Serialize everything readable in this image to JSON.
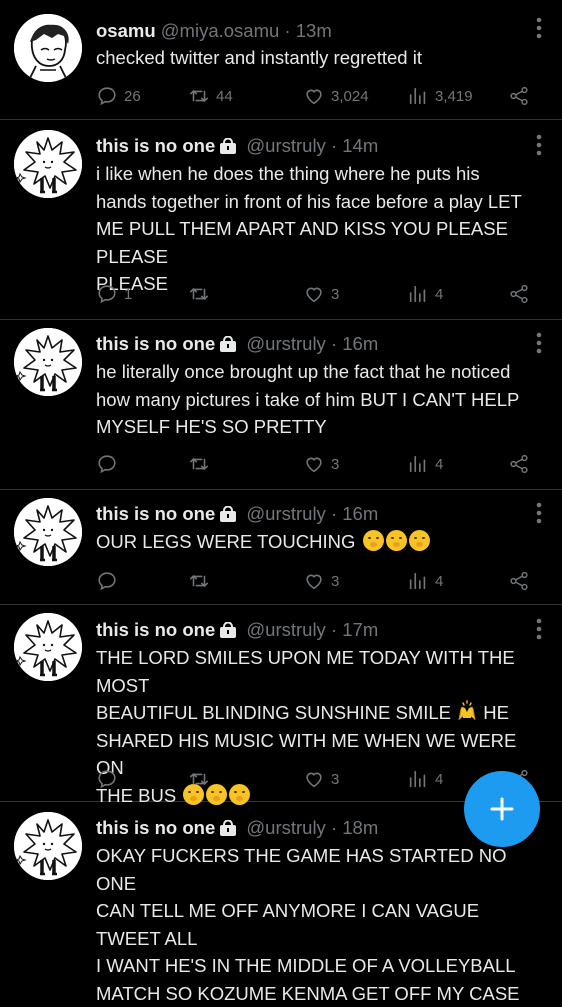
{
  "tweets": [
    {
      "name": "osamu",
      "handle": "@miya.osamu",
      "time": "13m",
      "text": "checked twitter and instantly regretted it",
      "replies": "26",
      "retweets": "44",
      "likes": "3,024",
      "views": "3,419",
      "avatar": "osamu-avatar",
      "locked": false
    },
    {
      "name": "this is no one",
      "handle": "@urstruly",
      "time": "14m",
      "text": "i like when he does the thing where he puts his\nhands together in front of his face before a play LET\nME PULL THEM APART AND KISS YOU PLEASE PLEASE\nPLEASE",
      "replies": "1",
      "retweets": "",
      "likes": "3",
      "views": "4",
      "avatar": "star-doodle-avatar",
      "locked": true
    },
    {
      "name": "this is no one",
      "handle": "@urstruly",
      "time": "16m",
      "text": "he literally once brought up the fact that he noticed\nhow many pictures i take of him BUT I CAN'T HELP\nMYSELF HE'S SO PRETTY",
      "replies": "",
      "retweets": "",
      "likes": "3",
      "views": "4",
      "avatar": "star-doodle-avatar",
      "locked": true
    },
    {
      "name": "this is no one",
      "handle": "@urstruly",
      "time": "16m",
      "text": "OUR LEGS WERE TOUCHING",
      "emoji_after": [
        "shushing-face-emoji",
        "shushing-face-emoji",
        "shushing-face-emoji"
      ],
      "replies": "",
      "retweets": "",
      "likes": "3",
      "views": "4",
      "avatar": "star-doodle-avatar",
      "locked": true
    },
    {
      "name": "this is no one",
      "handle": "@urstruly",
      "time": "17m",
      "text_line1": "THE LORD SMILES UPON ME TODAY WITH THE MOST",
      "text_line2a": "BEAUTIFUL BLINDING SUNSHINE SMILE",
      "text_line2b": "HE",
      "text_line3": "SHARED HIS MUSIC WITH ME WHEN WE WERE ON",
      "text_line4": "THE BUS",
      "replies": "",
      "retweets": "",
      "likes": "3",
      "views": "4",
      "avatar": "star-doodle-avatar",
      "locked": true
    },
    {
      "name": "this is no one",
      "handle": "@urstruly",
      "time": "18m",
      "text": "OKAY FUCKERS THE GAME HAS STARTED NO ONE\nCAN TELL ME OFF ANYMORE I CAN VAGUE TWEET ALL\nI WANT HE'S IN THE MIDDLE OF A VOLLEYBALL\nMATCH SO KOZUME KENMA GET OFF MY CASE",
      "avatar": "star-doodle-avatar",
      "locked": true
    }
  ],
  "separator": " · ",
  "compose_button": "plus-icon",
  "colors": {
    "background": "#000000",
    "text": "#e7e9ea",
    "muted": "#71767b",
    "accent": "#1d9bf0",
    "divider": "#2f3336"
  }
}
